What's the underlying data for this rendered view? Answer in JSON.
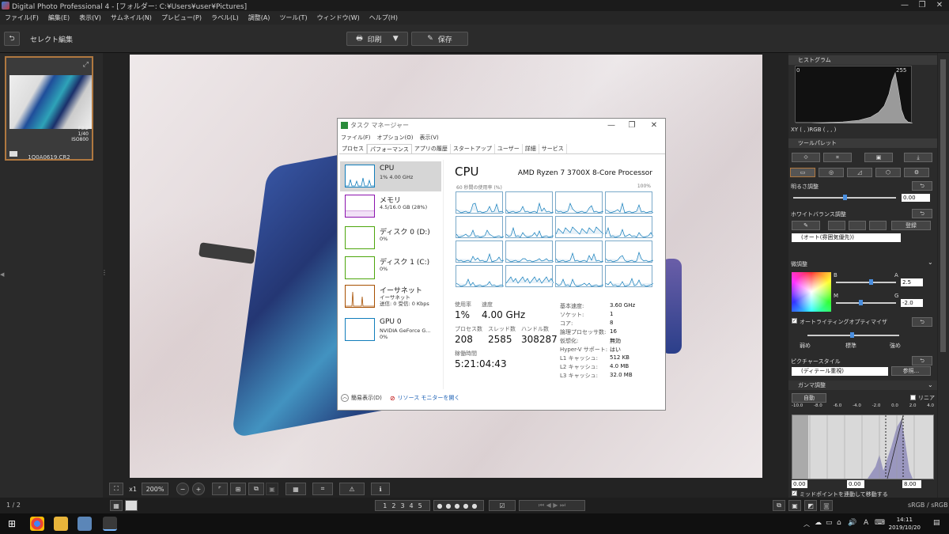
{
  "window": {
    "title": "Digital Photo Professional 4 - [フォルダー: C:¥Users¥user¥Pictures]",
    "controls": [
      "—",
      "❐",
      "✕"
    ]
  },
  "menu": [
    "ファイル(F)",
    "編集(E)",
    "表示(V)",
    "サムネイル(N)",
    "プレビュー(P)",
    "ラベル(L)",
    "調整(A)",
    "ツール(T)",
    "ウィンドウ(W)",
    "ヘルプ(H)"
  ],
  "toolbar": {
    "mode_label": "セレクト編集",
    "print_label": "印刷",
    "save_label": "保存"
  },
  "thumbnail": {
    "aperture": "F3.2",
    "shutter": "1/40",
    "iso": "ISO800",
    "filename": "1Q0A0619.CR2"
  },
  "viewer": {
    "zoom_1x": "x1",
    "zoom_value": "200%"
  },
  "status": {
    "page_indicator": "1 / 2",
    "ratings": [
      "1",
      "2",
      "3",
      "4",
      "5"
    ],
    "color_space": "sRGB / sRGB"
  },
  "right_panel": {
    "histogram_title": "ヒストグラム",
    "histo_min": "0",
    "histo_max": "255",
    "xy_readout": "XY (   ,   )RGB (   ,   ,   )",
    "tool_palette_title": "ツールパレット",
    "brightness_title": "明るさ調整",
    "brightness_value": "0.00",
    "wb_title": "ホワイトバランス調整",
    "wb_button": "登録",
    "wb_mode": "(オート(雰囲気優先))",
    "fine_title": "微調整",
    "fine_b": "B",
    "fine_a": "A",
    "fine_m": "M",
    "fine_g": "G",
    "fine_a_value": "2.5",
    "fine_g_value": "-2.0",
    "alo_title": "オートライティングオプティマイザ",
    "alo_levels": [
      "弱め",
      "標準",
      "強め"
    ],
    "ps_title": "ピクチャースタイル",
    "ps_value": "(ディテール重視)",
    "ps_button": "参照...",
    "gamma_title": "ガンマ調整",
    "gamma_auto": "自動",
    "gamma_linear": "リニア",
    "gamma_ticks": [
      "-10.0",
      "-8.0",
      "-6.0",
      "-4.0",
      "-2.0",
      "0.0",
      "2.0",
      "4.0"
    ],
    "gamma_left_value": "0.00",
    "gamma_mid_value": "0.00",
    "gamma_right_value": "8.00",
    "midpoint_label": "ミッドポイントを連動して移動する"
  },
  "taskbar": {
    "time": "14:11",
    "date": "2019/10/20",
    "ime": "A"
  },
  "task_manager": {
    "title": "タスク マネージャー",
    "menu": [
      "ファイル(F)",
      "オプション(O)",
      "表示(V)"
    ],
    "tabs": [
      "プロセス",
      "パフォーマンス",
      "アプリの履歴",
      "スタートアップ",
      "ユーザー",
      "詳細",
      "サービス"
    ],
    "active_tab": 1,
    "side": [
      {
        "name": "CPU",
        "sub": "1%  4.00 GHz",
        "sub2": "",
        "color": "#117dbb"
      },
      {
        "name": "メモリ",
        "sub": "4.5/16.0 GB (28%)",
        "sub2": "",
        "color": "#8b12ae"
      },
      {
        "name": "ディスク 0 (D:)",
        "sub": "0%",
        "sub2": "",
        "color": "#4da60c"
      },
      {
        "name": "ディスク 1 (C:)",
        "sub": "0%",
        "sub2": "",
        "color": "#4da60c"
      },
      {
        "name": "イーサネット",
        "sub": "イーサネット",
        "sub2": "送信: 0 受信: 0 Kbps",
        "color": "#a74f01"
      },
      {
        "name": "GPU 0",
        "sub": "NVIDIA GeForce G...",
        "sub2": "0%",
        "color": "#117dbb"
      }
    ],
    "main": {
      "heading": "CPU",
      "model": "AMD Ryzen 7 3700X 8-Core Processor",
      "caption_left": "60 秒間の使用率 (%)",
      "caption_right": "100%",
      "usage_label": "使用率",
      "usage_value": "1%",
      "speed_label": "速度",
      "speed_value": "4.00 GHz",
      "proc_label": "プロセス数",
      "proc_value": "208",
      "thread_label": "スレッド数",
      "thread_value": "2585",
      "handle_label": "ハンドル数",
      "handle_value": "308287",
      "uptime_label": "稼働時間",
      "uptime_value": "5:21:04:43",
      "info": [
        {
          "label": "基本速度:",
          "value": "3.60 GHz"
        },
        {
          "label": "ソケット:",
          "value": "1"
        },
        {
          "label": "コア:",
          "value": "8"
        },
        {
          "label": "論理プロセッサ数:",
          "value": "16"
        },
        {
          "label": "仮想化:",
          "value": "無効"
        },
        {
          "label": "Hyper-V サポート:",
          "value": "はい"
        },
        {
          "label": "L1 キャッシュ:",
          "value": "512 KB"
        },
        {
          "label": "L2 キャッシュ:",
          "value": "4.0 MB"
        },
        {
          "label": "L3 キャッシュ:",
          "value": "32.0 MB"
        }
      ]
    },
    "footer": {
      "compact_label": "簡易表示(D)",
      "monitor_label": "リソース モニターを開く"
    }
  }
}
